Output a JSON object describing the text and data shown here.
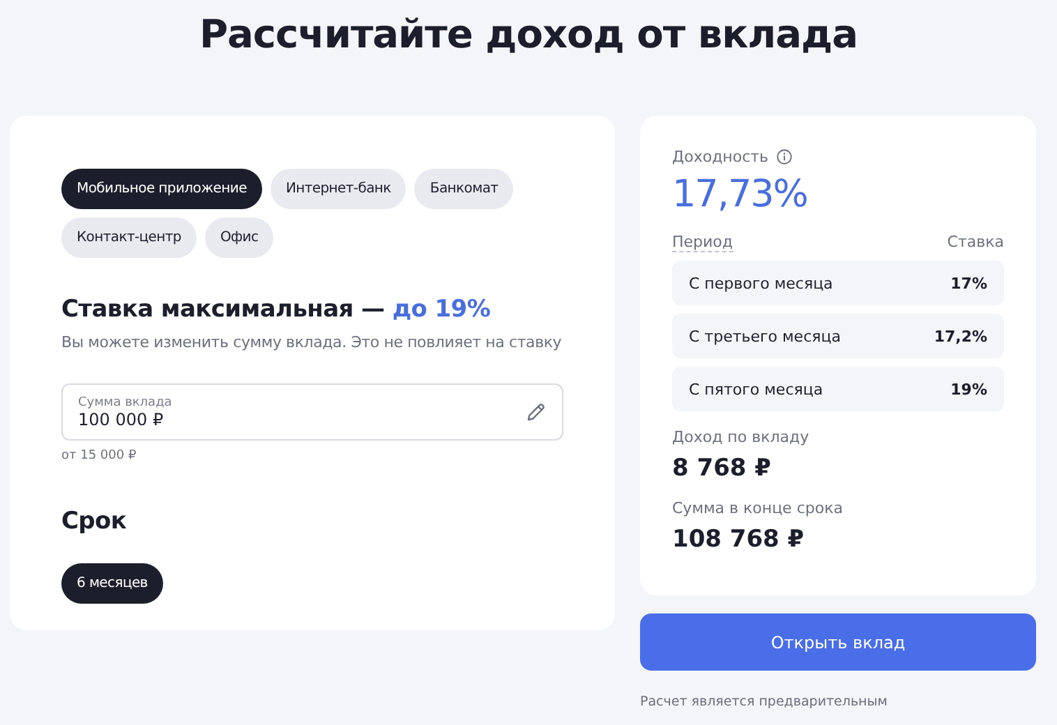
{
  "title": "Рассчитайте доход от вклада",
  "channels": [
    {
      "label": "Мобильное приложение",
      "selected": true
    },
    {
      "label": "Интернет-банк",
      "selected": false
    },
    {
      "label": "Банкомат",
      "selected": false
    },
    {
      "label": "Контакт-центр",
      "selected": false
    },
    {
      "label": "Офис",
      "selected": false
    }
  ],
  "rate_heading": "Ставка максимальная — ",
  "rate_highlight": "до 19%",
  "rate_note": "Вы можете изменить сумму вклада. Это не повлияет на ставку",
  "amount_field": {
    "label": "Сумма вклада",
    "value": "100 000 ₽",
    "hint": "от 15 000 ₽"
  },
  "term_heading": "Срок",
  "terms": [
    {
      "label": "6 месяцев",
      "selected": true
    }
  ],
  "summary": {
    "yield_label": "Доходность",
    "yield_value": "17,73%",
    "columns": [
      "Период",
      "Ставка"
    ],
    "rows": [
      {
        "period": "С первого месяца",
        "rate": "17%"
      },
      {
        "period": "С третьего месяца",
        "rate": "17,2%"
      },
      {
        "period": "С пятого месяца",
        "rate": "19%"
      }
    ],
    "income_label": "Доход по вкладу",
    "income_value": "8 768 ₽",
    "total_label": "Сумма в конце срока",
    "total_value": "108 768 ₽"
  },
  "open_button": "Открыть вклад",
  "footnote": "Расчет является предварительным"
}
